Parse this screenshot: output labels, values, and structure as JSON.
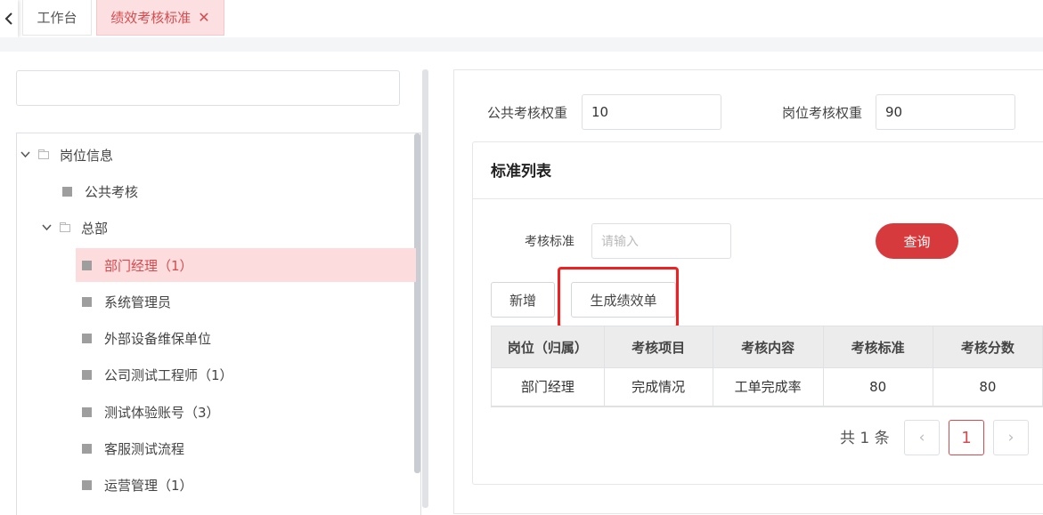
{
  "tabs": {
    "home_label": "工作台",
    "active_label": "绩效考核标准",
    "close_glyph": "✕"
  },
  "tree": {
    "search_value": "",
    "nodes": [
      {
        "label": "岗位信息",
        "type": "folder",
        "expanded": true
      },
      {
        "label": "公共考核",
        "type": "leaf"
      },
      {
        "label": "总部",
        "type": "folder",
        "expanded": true
      },
      {
        "label": "部门经理（1）",
        "type": "leaf",
        "selected": true
      },
      {
        "label": "系统管理员",
        "type": "leaf"
      },
      {
        "label": "外部设备维保单位",
        "type": "leaf"
      },
      {
        "label": "公司测试工程师（1）",
        "type": "leaf"
      },
      {
        "label": "测试体验账号（3）",
        "type": "leaf"
      },
      {
        "label": "客服测试流程",
        "type": "leaf"
      },
      {
        "label": "运营管理（1）",
        "type": "leaf"
      }
    ]
  },
  "weights": {
    "public_label": "公共考核权重",
    "public_value": "10",
    "post_label": "岗位考核权重",
    "post_value": "90"
  },
  "standard_list": {
    "title": "标准列表",
    "filter_label": "考核标准",
    "filter_placeholder": "请输入",
    "query_label": "查询",
    "add_label": "新增",
    "generate_label": "生成绩效单",
    "columns": [
      "岗位（归属）",
      "考核项目",
      "考核内容",
      "考核标准",
      "考核分数"
    ],
    "rows": [
      [
        "部门经理",
        "完成情况",
        "工单完成率",
        "80",
        "80"
      ]
    ]
  },
  "pagination": {
    "total_text": "共 1 条",
    "prev_glyph": "‹",
    "current_page": "1",
    "next_glyph": "›"
  },
  "colors": {
    "accent": "#d63a3d",
    "selected_bg": "#fcdcdd",
    "highlight_box": "#f11f1f"
  }
}
